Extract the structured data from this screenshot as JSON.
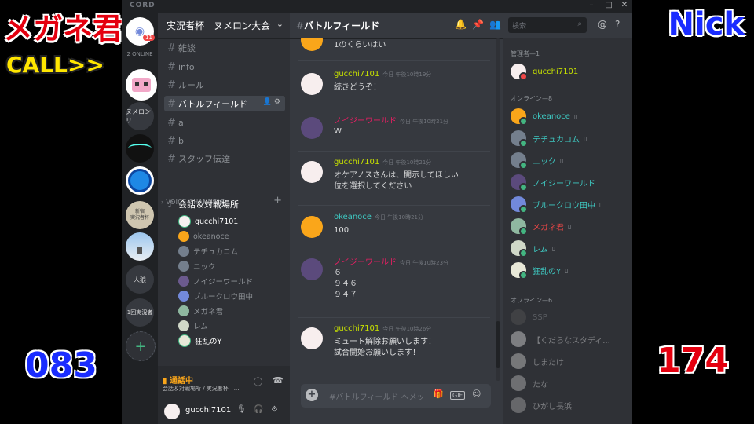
{
  "overlay": {
    "left_name": "メガネ君",
    "call": "CALL>>",
    "right_name": "Nick",
    "left_score": "083",
    "right_score": "174"
  },
  "titlebar": {
    "brand": "CORD"
  },
  "guilds": {
    "badge": "11",
    "online": "2 ONLINE",
    "items": [
      "ヌメロンリ",
      "新宿\n実況者杯",
      "人狼",
      "1回実況者",
      "+"
    ]
  },
  "server": {
    "name": "実況者杯　ヌメロン大会",
    "channels": [
      {
        "name": "雑談"
      },
      {
        "name": "info"
      },
      {
        "name": "ルール"
      },
      {
        "name": "バトルフィールド"
      },
      {
        "name": "a"
      },
      {
        "name": "b"
      },
      {
        "name": "スタッフ伝達"
      }
    ],
    "voice_category": "VOICE CHANNELS",
    "voice_channel": "会話＆対戦場所",
    "voice_users": [
      "gucchi7101",
      "okeanoce",
      "テチュカコム",
      "ニック",
      "ノイジーワールド",
      "ブルークロウ田中",
      "メガネ君",
      "レム",
      "狂乱のY"
    ]
  },
  "voice_panel": {
    "status": "通話中",
    "sub": "会話＆対戦場所 / 実況者杯　..."
  },
  "user_panel": {
    "name": "gucchi7101"
  },
  "chat": {
    "title": "バトルフィールド",
    "search_placeholder": "検索",
    "composer_placeholder": "#バトルフィールド へメッセージを送信",
    "gif": "GIF",
    "messages": [
      {
        "author": "",
        "time": "",
        "body": "1のくらいはい"
      },
      {
        "author": "gucchi7101",
        "time": "今日 午後10時19分",
        "body": "続きどうぞ！"
      },
      {
        "author": "ノイジーワールド",
        "time": "今日 午後10時21分",
        "body": "W"
      },
      {
        "author": "gucchi7101",
        "time": "今日 午後10時21分",
        "body": "オケアノスさんは、開示してほしい\n位を選択してください"
      },
      {
        "author": "okeanoce",
        "time": "今日 午後10時21分",
        "body": "100"
      },
      {
        "author": "ノイジーワールド",
        "time": "今日 午後10時23分",
        "body": "６\n９４６\n９４７"
      },
      {
        "author": "gucchi7101",
        "time": "今日 午後10時26分",
        "body": "ミュート解除お願いします！\n試合開始お願いします！"
      }
    ]
  },
  "members": {
    "admin_label": "管理者—1",
    "online_label": "オンライン—8",
    "offline_label": "オフライン—6",
    "admin": [
      {
        "name": "gucchi7101",
        "color": "#c7e000"
      }
    ],
    "online": [
      {
        "name": "okeanoce",
        "color": "#3ec9c2",
        "phone": true
      },
      {
        "name": "テチュカコム",
        "color": "#3ec9c2",
        "phone": true
      },
      {
        "name": "ニック",
        "color": "#3ec9c2",
        "phone": true
      },
      {
        "name": "ノイジーワールド",
        "color": "#3ec9c2",
        "phone": false
      },
      {
        "name": "ブルークロウ田中",
        "color": "#3ec9c2",
        "phone": true
      },
      {
        "name": "メガネ君",
        "color": "#f04747",
        "phone": true
      },
      {
        "name": "レム",
        "color": "#3ec9c2",
        "phone": true
      },
      {
        "name": "狂乱のY",
        "color": "#3ec9c2",
        "phone": true
      }
    ],
    "offline": [
      "SSP",
      "【くだらなスタディ...",
      "しまたけ",
      "たな",
      "ひがし長浜"
    ]
  },
  "colors": {
    "admin_name": "#c7e000",
    "noisy_name": "#e91e63",
    "okeanoce_name": "#3ec9c2",
    "online_dot": "#43b581",
    "dnd_dot": "#f04747",
    "call_status": "#faa61a"
  }
}
